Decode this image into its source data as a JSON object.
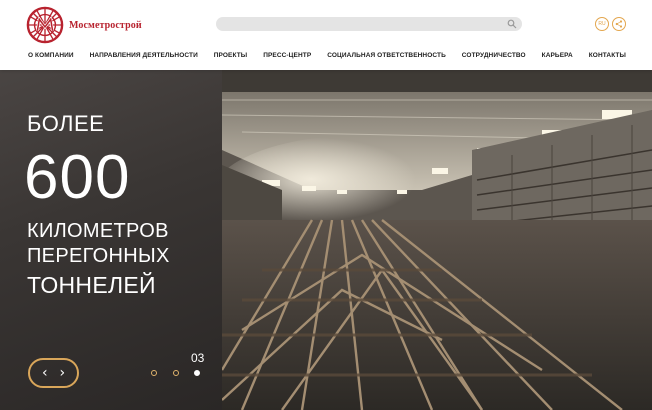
{
  "header": {
    "logo_text": "Мосметрострой",
    "lang": "RU"
  },
  "nav": [
    "О компании",
    "Направления деятельности",
    "Проекты",
    "Пресс-центр",
    "Социальная ответственность",
    "Сотрудничество",
    "Карьера",
    "Контакты"
  ],
  "hero": {
    "line_top": "БОЛЕЕ",
    "number": "600",
    "line1": "КИЛОМЕТРОВ",
    "line2": "ПЕРЕГОННЫХ",
    "line3": "ТОННЕЛЕЙ",
    "slide_number": "03",
    "active_slide": 3,
    "slides_total": 3
  },
  "colors": {
    "brand": "#b8232f",
    "accent": "#d9a65a",
    "panel": "#3a3634"
  }
}
